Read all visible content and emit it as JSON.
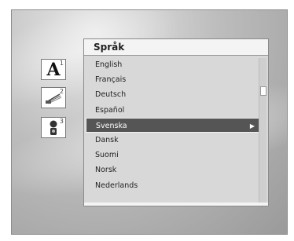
{
  "side_icons": [
    {
      "name": "subtitle-language-icon",
      "glyph": "A",
      "number": "1"
    },
    {
      "name": "audio-language-icon",
      "glyph": "♫",
      "number": "2"
    },
    {
      "name": "speaker-icon",
      "glyph": "☊",
      "number": "3"
    }
  ],
  "menu": {
    "title": "Språk",
    "items": [
      {
        "label": "English"
      },
      {
        "label": "Français"
      },
      {
        "label": "Deutsch"
      },
      {
        "label": "Español"
      },
      {
        "label": "Svenska",
        "selected": true
      },
      {
        "label": "Dansk"
      },
      {
        "label": "Suomi"
      },
      {
        "label": "Norsk"
      },
      {
        "label": "Nederlands"
      }
    ],
    "selected_arrow": "▶"
  }
}
